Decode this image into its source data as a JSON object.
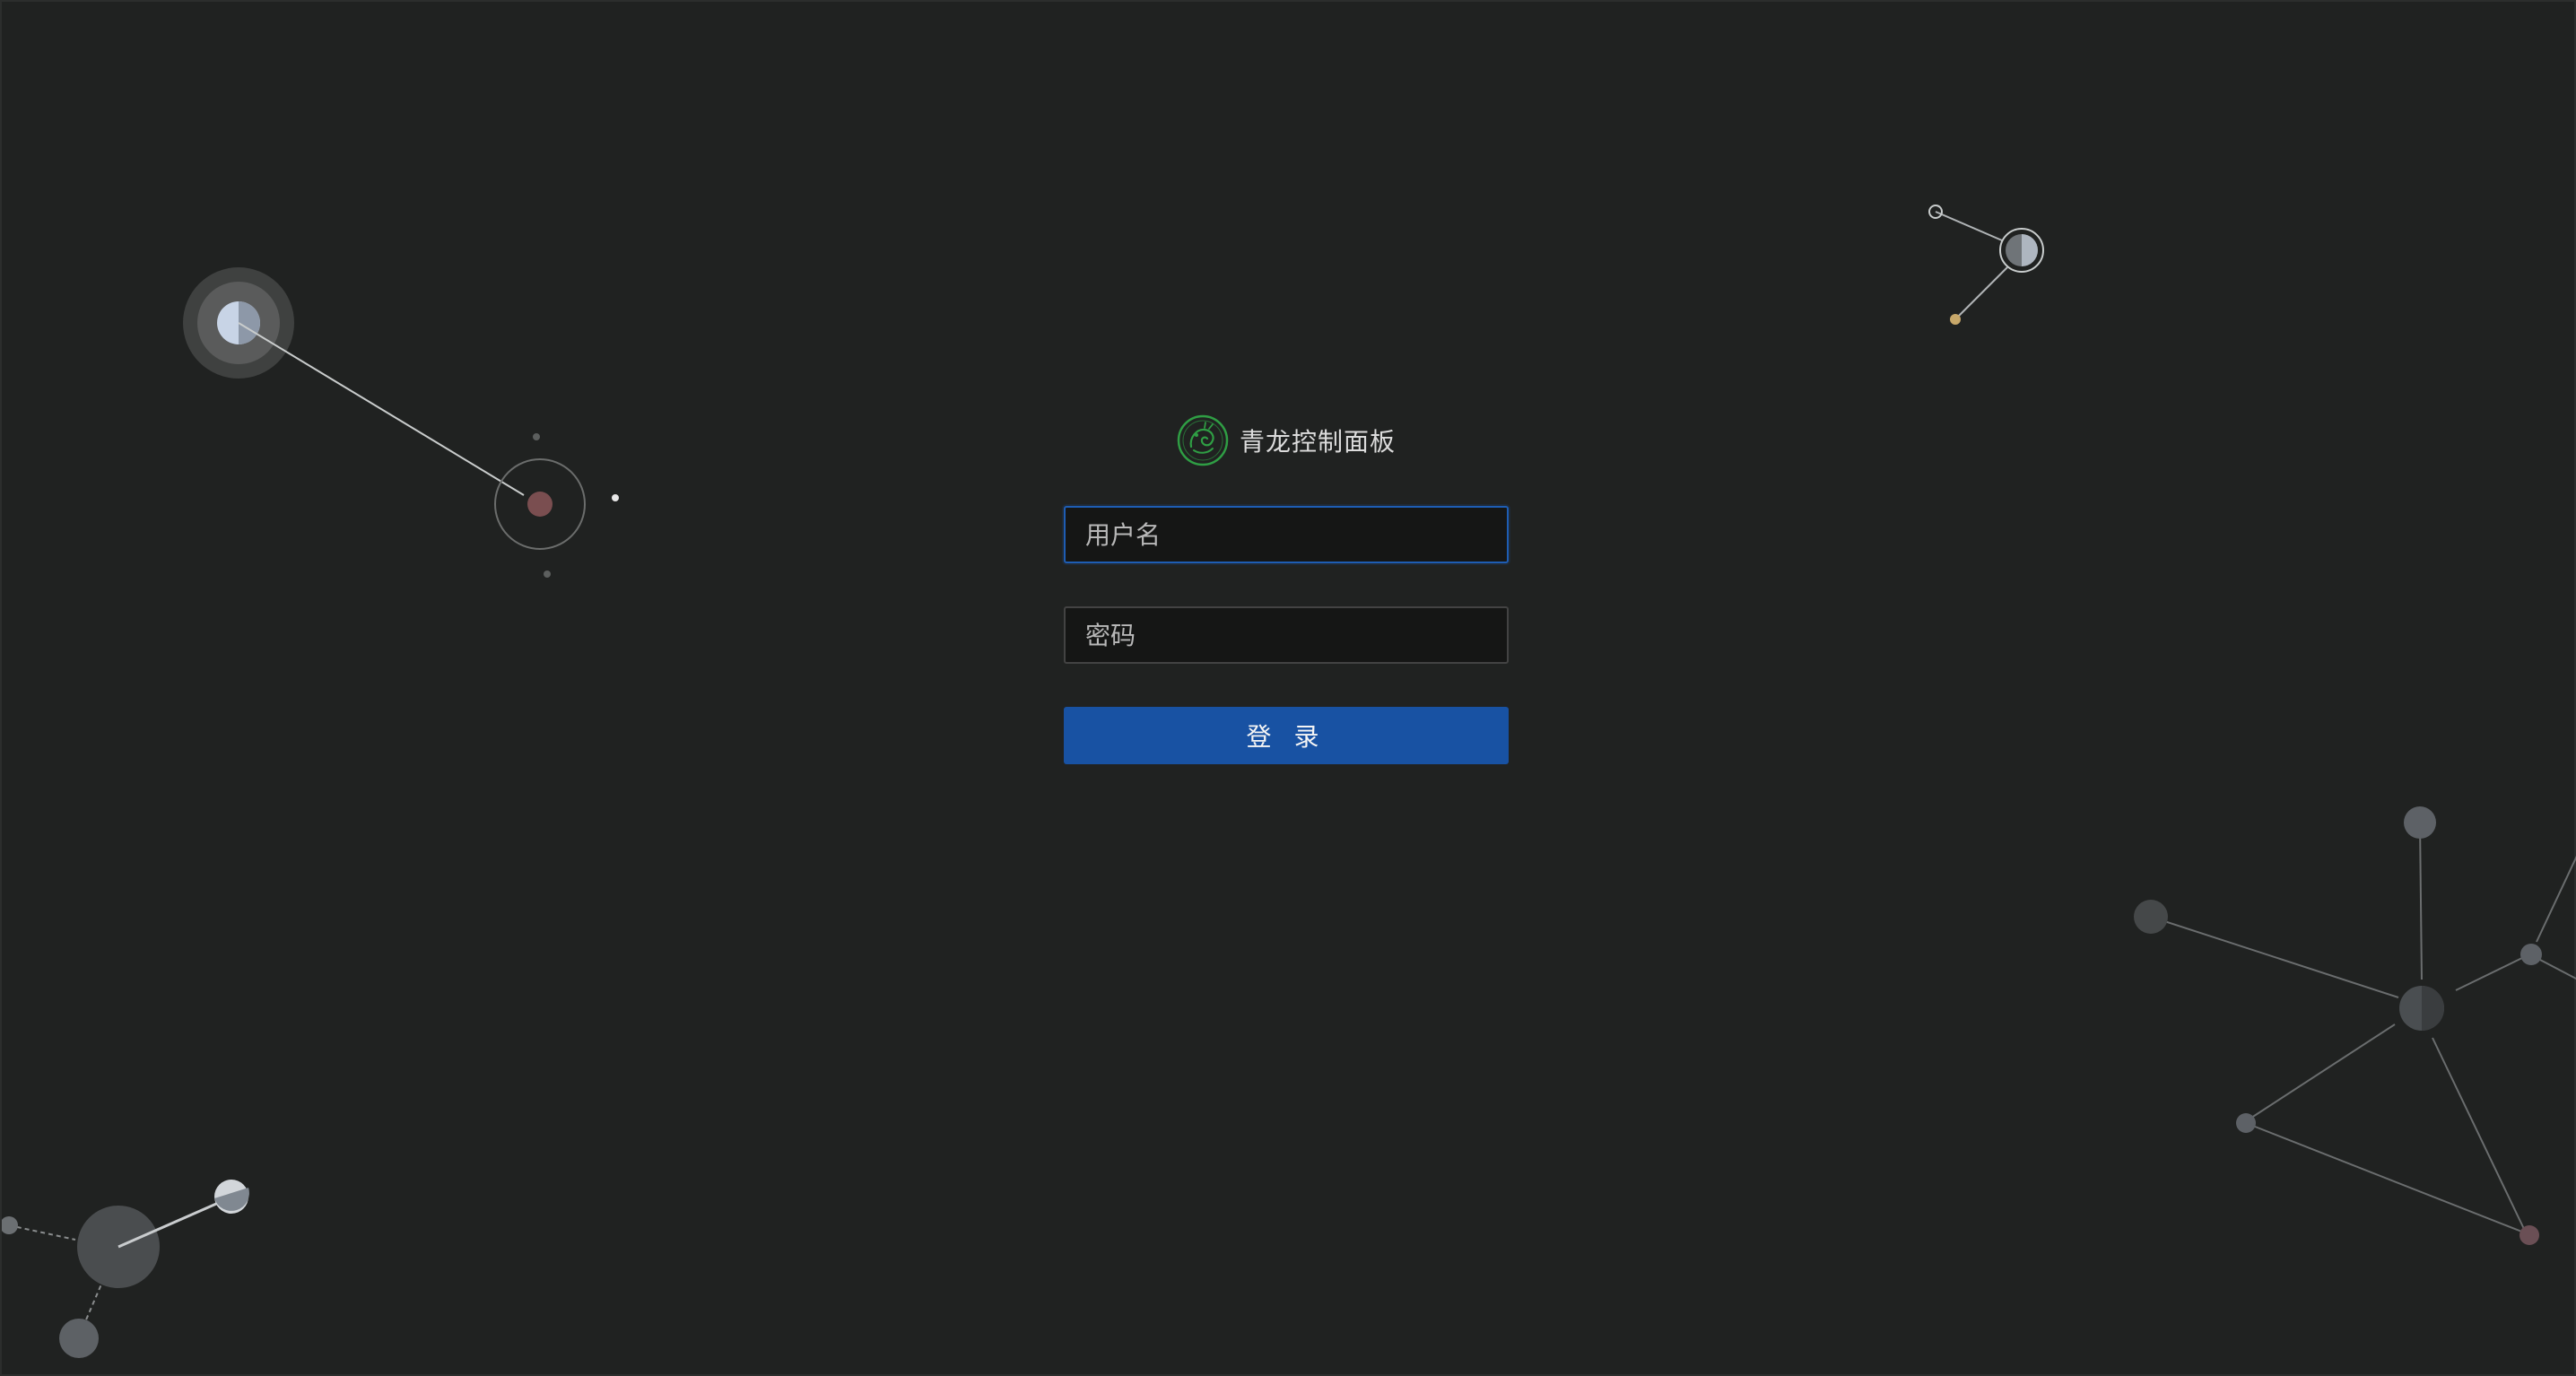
{
  "brand": {
    "title": "青龙控制面板",
    "logo_icon": "dragon-logo-icon",
    "logo_color": "#2f9e44"
  },
  "form": {
    "username_placeholder": "用户名",
    "username_value": "",
    "password_placeholder": "密码",
    "password_value": "",
    "login_label": "登 录"
  },
  "colors": {
    "background": "#202221",
    "input_background": "#151615",
    "input_border": "#434343",
    "focus_border": "#1e5db3",
    "button_background": "#1852a3",
    "button_text": "#f5f5f5"
  }
}
